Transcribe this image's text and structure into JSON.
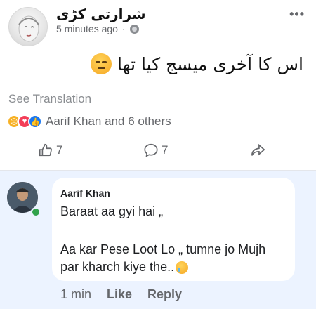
{
  "post": {
    "author": "شرارتی کڑی",
    "time": "5 minutes ago",
    "privacy_dot": "·",
    "more_icon": "•••",
    "text": "اس کا آخری میسج کیا تھا",
    "see_translation": "See Translation",
    "reactions_text": "Aarif Khan and 6 others",
    "like_count": "7",
    "comment_count": "7"
  },
  "comment": {
    "author": "Aarif Khan",
    "line1": "Baraat aa gyi hai „",
    "line2": "Aa kar Pese Loot Lo „ tumne jo Mujh",
    "line3": "par kharch kiye the..",
    "time": "1 min",
    "like_label": "Like",
    "reply_label": "Reply"
  },
  "colors": {
    "accent": "#1877f2",
    "comment_bg": "#ecf3ff",
    "online": "#31a24c"
  },
  "icons": [
    "more-icon",
    "globe-icon",
    "unamused-emoji-icon",
    "sad-reaction-icon",
    "love-reaction-icon",
    "like-reaction-icon",
    "like-icon",
    "comment-icon",
    "share-icon",
    "tear-emoji-icon"
  ]
}
